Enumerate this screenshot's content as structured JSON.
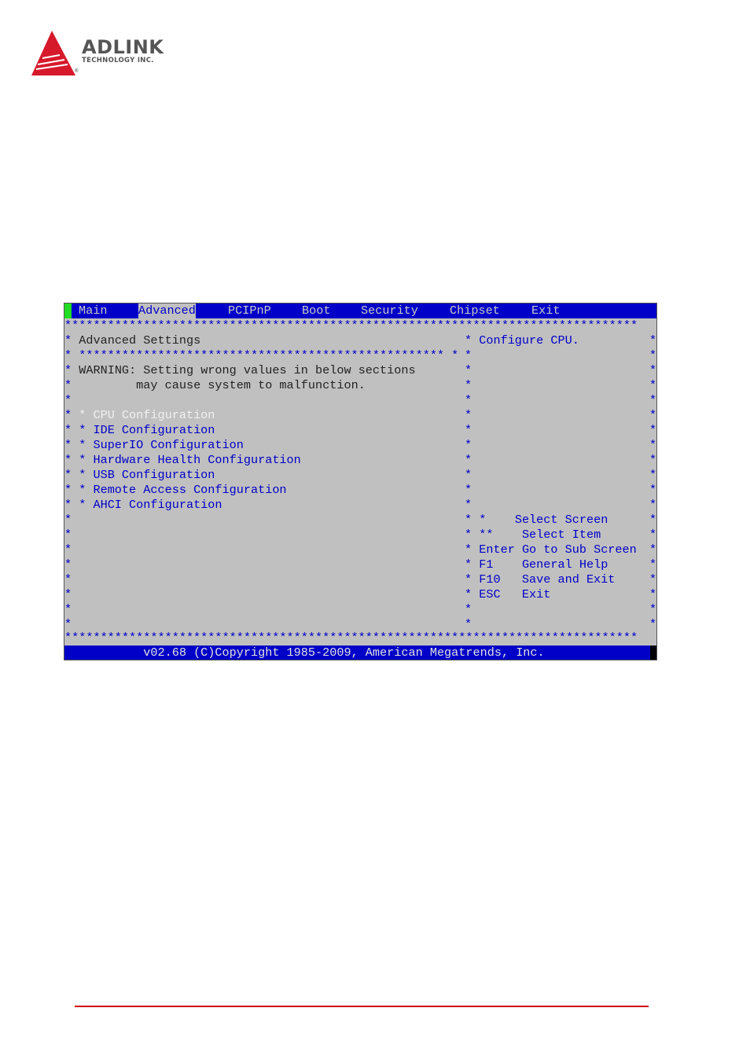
{
  "logo": {
    "brand": "ADLINK",
    "subtitle": "TECHNOLOGY INC.",
    "registered": "®",
    "accent_color": "#d7192c"
  },
  "bios": {
    "menu": [
      {
        "label": "Main",
        "active": false
      },
      {
        "label": "Advanced",
        "active": true
      },
      {
        "label": "PCIPnP",
        "active": false
      },
      {
        "label": "Boot",
        "active": false
      },
      {
        "label": "Security",
        "active": false
      },
      {
        "label": "Chipset",
        "active": false
      },
      {
        "label": "Exit",
        "active": false
      }
    ],
    "section_title": "Advanced Settings",
    "warning_line1": "WARNING: Setting wrong values in below sections",
    "warning_line2": "may cause system to malfunction.",
    "items": [
      {
        "label": "CPU Configuration",
        "selected": true
      },
      {
        "label": "IDE Configuration",
        "selected": false
      },
      {
        "label": "SuperIO Configuration",
        "selected": false
      },
      {
        "label": "Hardware Health Configuration",
        "selected": false
      },
      {
        "label": "USB Configuration",
        "selected": false
      },
      {
        "label": "Remote Access Configuration",
        "selected": false
      },
      {
        "label": "AHCI Configuration",
        "selected": false
      }
    ],
    "help_text": "Configure CPU.",
    "keys": [
      {
        "key": "*",
        "desc": "Select Screen"
      },
      {
        "key": "**",
        "desc": "Select Item"
      },
      {
        "key": "Enter",
        "desc": "Go to Sub Screen"
      },
      {
        "key": "F1",
        "desc": "General Help"
      },
      {
        "key": "F10",
        "desc": "Save and Exit"
      },
      {
        "key": "ESC",
        "desc": "Exit"
      }
    ],
    "footer": "v02.68 (C)Copyright 1985-2009, American Megatrends, Inc.",
    "colors": {
      "background": "#c0c0c0",
      "bar": "#0000c8",
      "text_blue": "#0000c8",
      "selected": "#f0f0f0",
      "cursor": "#22dd22"
    }
  }
}
